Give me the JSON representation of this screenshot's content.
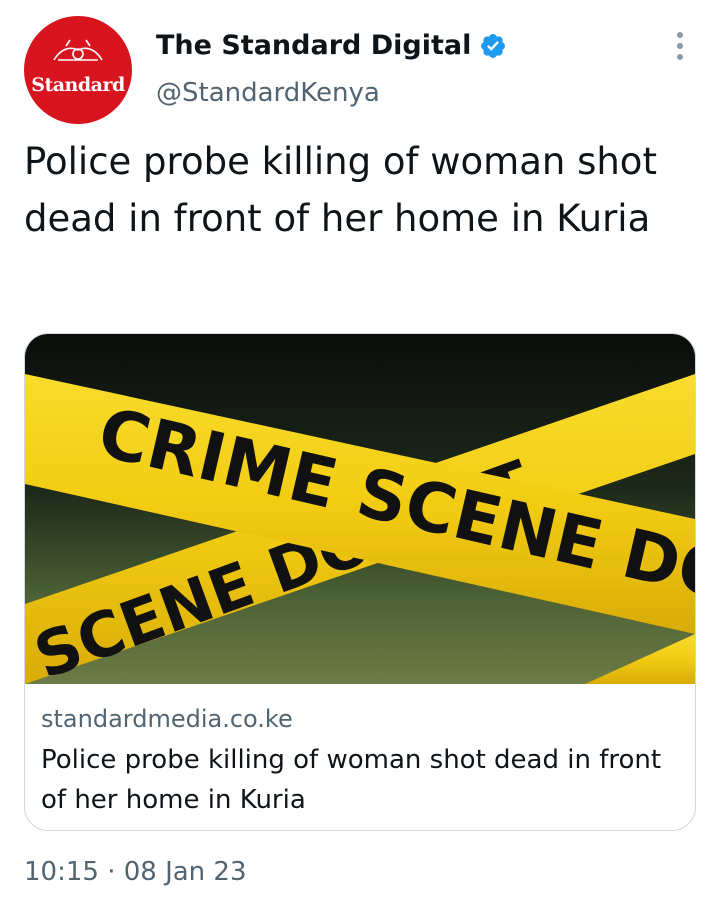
{
  "account": {
    "avatar_text": "Standard",
    "display_name": "The Standard Digital",
    "handle": "@StandardKenya",
    "verified": true
  },
  "tweet": {
    "text": "Police probe killing of woman shot dead in front of her home in Kuria",
    "timestamp": "10:15 · 08 Jan 23"
  },
  "card": {
    "image_tape_texts": [
      "CRIME SCENE DO NOT CRO",
      "SCENE DO NOT"
    ],
    "domain": "standardmedia.co.ke",
    "title": "Police probe killing of woman shot dead in front of her home in Kuria"
  },
  "icons": {
    "verified": "verified-badge-icon",
    "more": "more-options-icon"
  },
  "colors": {
    "brand_red": "#d8141f",
    "verified_blue": "#1d9bf0",
    "tape_yellow": "#f3cf1a",
    "secondary_text": "#536471"
  }
}
